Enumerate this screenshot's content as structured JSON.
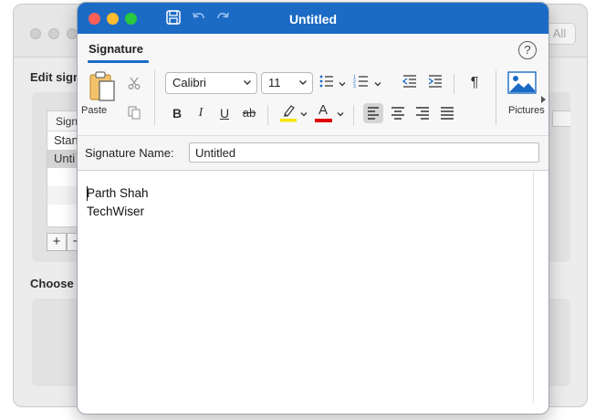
{
  "background_window": {
    "all_button": "All",
    "edit_label": "Edit sign",
    "list_header": "Signa",
    "list_items": [
      "Stan",
      "Unti"
    ],
    "choose_label": "Choose",
    "add_symbol": "+",
    "remove_symbol": "−"
  },
  "window": {
    "title": "Untitled",
    "title_icons": [
      "save-icon",
      "undo-icon",
      "redo-icon"
    ]
  },
  "ribbon": {
    "tab": "Signature",
    "help_symbol": "?",
    "paste_label": "Paste",
    "font_name": "Calibri",
    "font_size": "11",
    "bold": "B",
    "italic": "I",
    "underline": "U",
    "strikethrough": "ab",
    "font_color_letter": "A",
    "pilcrow": "¶",
    "pictures_label": "Pictures",
    "highlight_color": "#f5e400",
    "font_color": "#e00000",
    "accent": "#1b6bc5"
  },
  "signature_name": {
    "label": "Signature Name:",
    "value": "Untitled"
  },
  "editor": {
    "lines": [
      "Parth Shah",
      "TechWiser"
    ]
  }
}
